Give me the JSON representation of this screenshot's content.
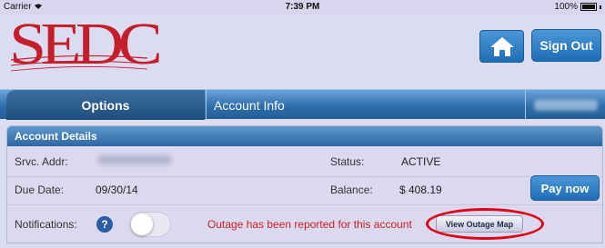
{
  "status_bar": {
    "carrier": "Carrier",
    "time": "7:39 PM",
    "battery": "100%"
  },
  "header": {
    "logo_text": "SEDC",
    "home_icon": "home-icon",
    "sign_out_label": "Sign Out"
  },
  "tabs": [
    {
      "label": "Options"
    },
    {
      "label": "Account Info"
    }
  ],
  "account_details": {
    "title": "Account Details",
    "service_address_label": "Srvc. Addr:",
    "status_label": "Status:",
    "status_value": "ACTIVE",
    "due_date_label": "Due Date:",
    "due_date_value": "09/30/14",
    "balance_label": "Balance:",
    "balance_value": "$ 408.19",
    "pay_now_label": "Pay now",
    "notifications_label": "Notifications:",
    "help_glyph": "?",
    "notifications_enabled": false,
    "outage_message": "Outage has been reported for this account",
    "view_outage_map_label": "View Outage Map"
  },
  "colors": {
    "accent_blue": "#2f6fae",
    "logo_red": "#c41e2c",
    "alert_red": "#d21c24",
    "background": "#dcdcf0"
  }
}
